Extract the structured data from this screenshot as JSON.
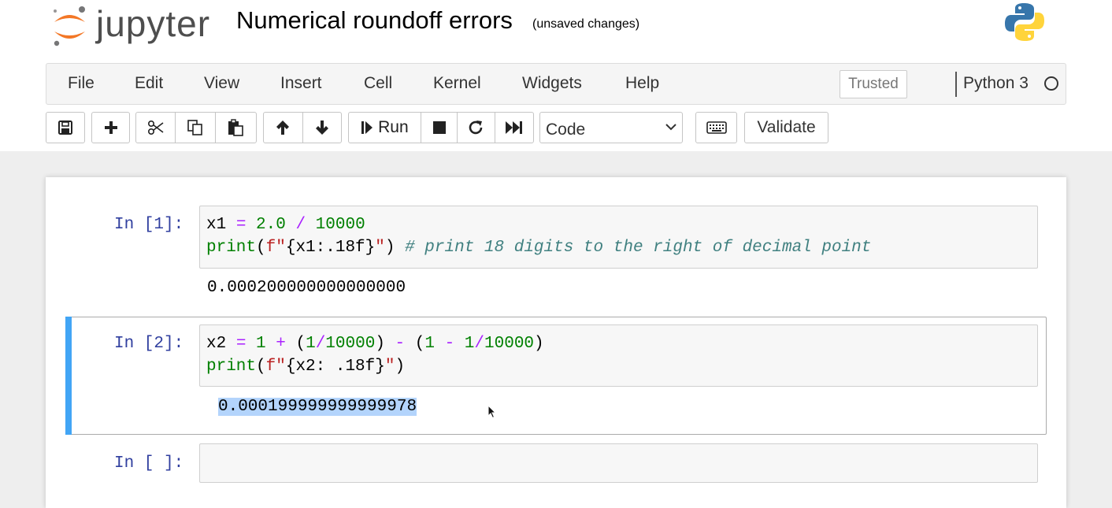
{
  "header": {
    "logo_text": "jupyter",
    "notebook_title": "Numerical roundoff errors",
    "save_status": "(unsaved changes)",
    "jupyter_brand_color": "#f37726",
    "python_logo_colors": [
      "#3776ab",
      "#ffd43b"
    ]
  },
  "menubar": {
    "items": [
      "File",
      "Edit",
      "View",
      "Insert",
      "Cell",
      "Kernel",
      "Widgets",
      "Help"
    ],
    "trusted_label": "Trusted",
    "kernel_name": "Python 3"
  },
  "toolbar": {
    "buttons": [
      {
        "icon": "save-icon"
      },
      {
        "icon": "plus-icon"
      },
      {
        "icon": "cut-icon"
      },
      {
        "icon": "copy-icon"
      },
      {
        "icon": "paste-icon"
      },
      {
        "icon": "arrow-up-icon"
      },
      {
        "icon": "arrow-down-icon"
      },
      {
        "icon": "run-icon",
        "label": "Run"
      },
      {
        "icon": "stop-icon"
      },
      {
        "icon": "restart-icon"
      },
      {
        "icon": "fast-forward-icon"
      }
    ],
    "run_label": "Run",
    "cell_type": "Code",
    "validate_label": "Validate",
    "keyboard_icon": "keyboard-icon"
  },
  "cells": [
    {
      "prompt": "In [1]:",
      "code_lines": [
        "x1 = 2.0 / 10000",
        "print(f\"{x1:.18f}\") # print 18 digits to the right of decimal point"
      ],
      "output": "0.000200000000000000"
    },
    {
      "prompt": "In [2]:",
      "code_lines": [
        "x2 = 1 + (1/10000) - (1 - 1/10000)",
        "print(f\"{x2: .18f}\")"
      ],
      "output": "0.000199999999999978",
      "selected": true
    },
    {
      "prompt": "In [ ]:",
      "code_lines": [],
      "output": ""
    }
  ],
  "colors": {
    "prompt": "#303f9f",
    "selected_cell_bar": "#42a5f5",
    "text_selection": "#b3d4fc",
    "syntax_operator": "#aa22ff",
    "syntax_number": "#008000",
    "syntax_string": "#ba2121",
    "syntax_comment": "#408080"
  }
}
